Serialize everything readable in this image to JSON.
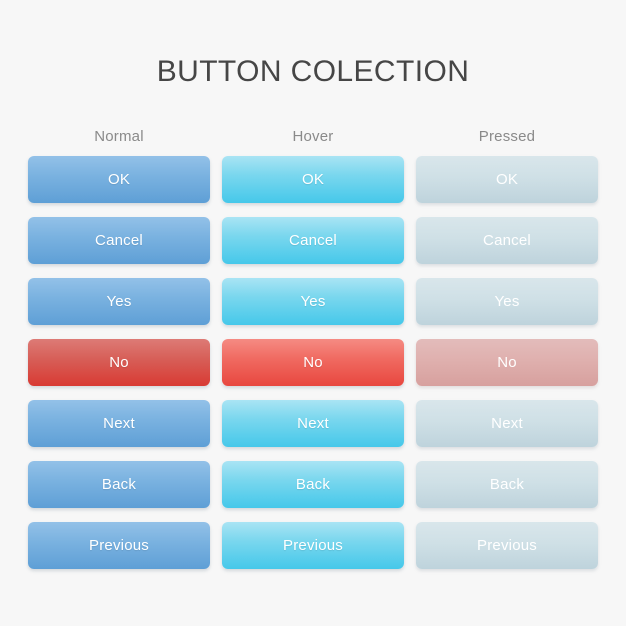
{
  "page": {
    "title": "BUTTON COLECTION",
    "background_color": "#f7f7f7",
    "title_color": "#464646"
  },
  "columns": [
    {
      "key": "normal",
      "label": "Normal"
    },
    {
      "key": "hover",
      "label": "Hover"
    },
    {
      "key": "pressed",
      "label": "Pressed"
    }
  ],
  "palette": {
    "blue_normal_top": "#93c1e8",
    "blue_normal_bottom": "#5e9fd6",
    "blue_hover_top": "#a9e4f4",
    "blue_hover_bottom": "#45c8ea",
    "blue_pressed_top": "#d9e6eb",
    "blue_pressed_bottom": "#bed3dc",
    "red_normal_top": "#dd7b76",
    "red_normal_bottom": "#d83a33",
    "red_hover_top": "#f58b83",
    "red_hover_bottom": "#e8473f",
    "red_pressed_top": "#e3bcbb",
    "red_pressed_bottom": "#d7a09e",
    "label_color": "#ffffff",
    "header_color": "#8a8a8a"
  },
  "rows": [
    {
      "label": "OK",
      "color": "blue"
    },
    {
      "label": "Cancel",
      "color": "blue"
    },
    {
      "label": "Yes",
      "color": "blue"
    },
    {
      "label": "No",
      "color": "red"
    },
    {
      "label": "Next",
      "color": "blue"
    },
    {
      "label": "Back",
      "color": "blue"
    },
    {
      "label": "Previous",
      "color": "blue"
    }
  ]
}
